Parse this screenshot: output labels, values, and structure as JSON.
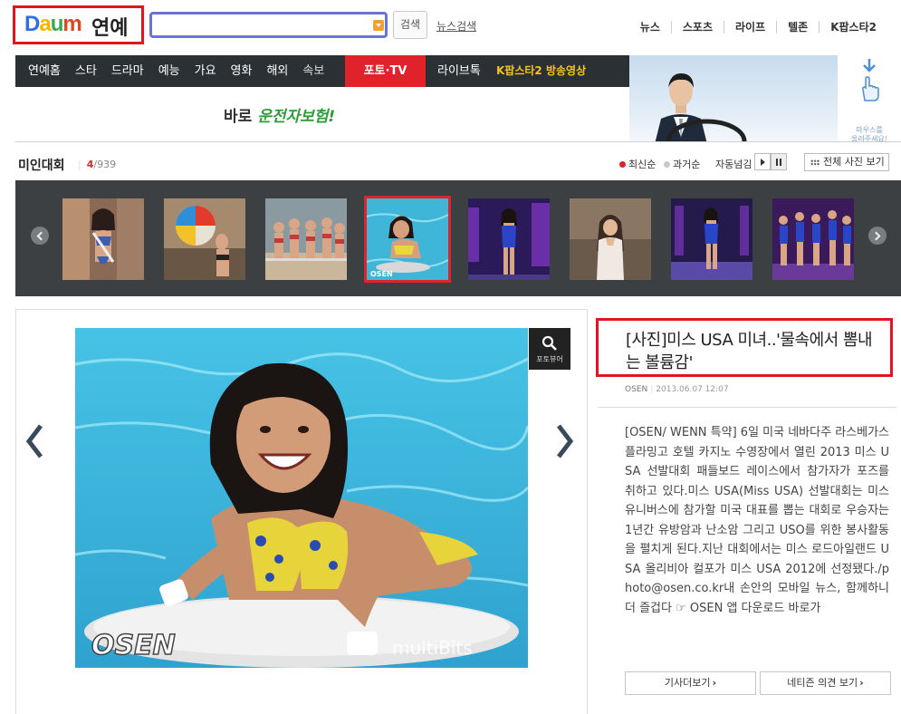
{
  "header": {
    "logo_text": "Daum",
    "logo_section": "연예",
    "search_placeholder": "",
    "search_button": "검색",
    "news_search": "뉴스검색",
    "top_nav": [
      "뉴스",
      "스포츠",
      "라이프",
      "텔존",
      "K팝스타2"
    ]
  },
  "gnb": {
    "items": [
      "연예홈",
      "스타",
      "드라마",
      "예능",
      "가요",
      "영화",
      "해외"
    ],
    "sub_item": "속보",
    "photo_tv": "포토·TV",
    "live": "라이브톡",
    "kpop": "K팝스타2 방송영상"
  },
  "ad": {
    "text_prefix": "바로 ",
    "text_highlight": "운전자보험!",
    "mouse_hint": [
      "마우스를",
      "올려주세요!"
    ]
  },
  "gallery": {
    "title": "미인대회",
    "current": "4",
    "total": "/939",
    "sort_new": "최신순",
    "sort_old": "과거순",
    "autoplay": "자동넘김",
    "view_all": "전체 사진 보기",
    "selected_index": 3,
    "thumbnail_count": 8
  },
  "photo": {
    "zoom_label": "포토뷰어",
    "watermark_left": "OSEN",
    "watermark_right": "multiBits"
  },
  "article": {
    "title": "[사진]미스 USA 미녀..'물속에서 뽐내는 볼륨감'",
    "source": "OSEN",
    "date": "2013.06.07 12:07",
    "body": "[OSEN/ WENN 특약] 6일 미국 네바다주 라스베가스 플라밍고 호텔 카지노 수영장에서 열린 2013 미스 USA 선발대회 패들보드 레이스에서 참가자가 포즈를 취하고 있다.미스 USA(Miss USA) 선발대회는 미스 유니버스에 참가할 미국 대표를 뽑는 대회로 우승자는 1년간 유방암과 난소암 그리고 USO를 위한 봉사활동을 펼치게 된다.지난 대회에서는 미스 로드아일랜드 USA 올리비아 컬포가 미스 USA 2012에 선정됐다./photo@osen.co.kr내 손안의 모바일 뉴스, 함께하니 더 즐겁다 ☞ OSEN 앱 다운로드 바로가",
    "btn_more": "기사더보기",
    "btn_opinion": "네티즌 의견 보기"
  },
  "colors": {
    "accent_red": "#e0222a",
    "gnb_bg": "#2b3035",
    "strip_bg": "#3d4043",
    "kpop_yellow": "#f5c51b",
    "ad_green": "#2f9c3a"
  }
}
